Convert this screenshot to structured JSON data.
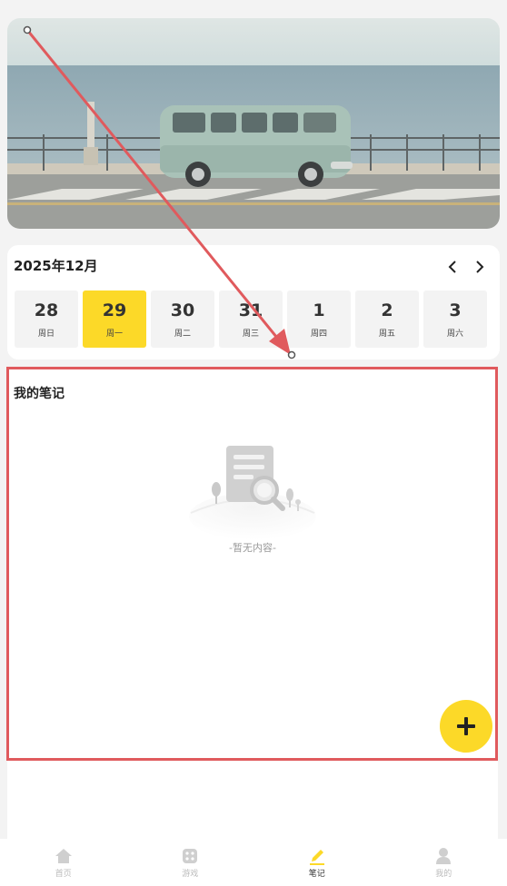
{
  "calendar": {
    "title": "2025年12月",
    "prev_icon": "chevron-left-icon",
    "next_icon": "chevron-right-icon",
    "days": [
      {
        "num": "28",
        "weekday": "周日",
        "selected": false
      },
      {
        "num": "29",
        "weekday": "周一",
        "selected": true
      },
      {
        "num": "30",
        "weekday": "周二",
        "selected": false
      },
      {
        "num": "31",
        "weekday": "周三",
        "selected": false
      },
      {
        "num": "1",
        "weekday": "周四",
        "selected": false
      },
      {
        "num": "2",
        "weekday": "周五",
        "selected": false
      },
      {
        "num": "3",
        "weekday": "周六",
        "selected": false
      }
    ]
  },
  "notes": {
    "title": "我的笔记",
    "empty_text": "-暂无内容-",
    "add_icon": "plus-icon"
  },
  "tabbar": {
    "items": [
      {
        "label": "首页",
        "icon": "home-icon",
        "active": false
      },
      {
        "label": "游戏",
        "icon": "dice-icon",
        "active": false
      },
      {
        "label": "笔记",
        "icon": "pencil-icon",
        "active": true
      },
      {
        "label": "我的",
        "icon": "user-icon",
        "active": false
      }
    ]
  },
  "colors": {
    "accent": "#fcd928",
    "annotation": "#e05a5d",
    "background": "#f3f3f3"
  }
}
